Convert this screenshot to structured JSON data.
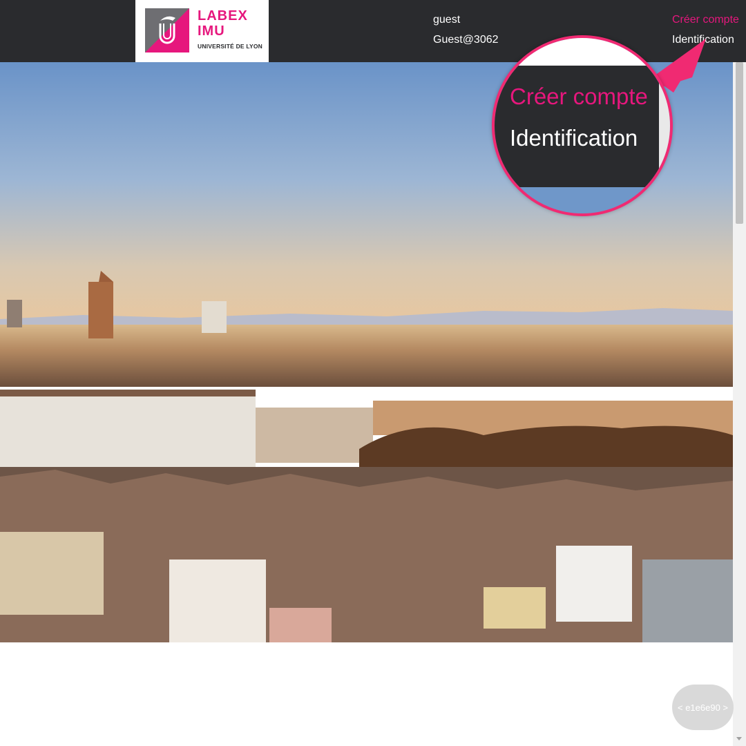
{
  "header": {
    "logo": {
      "line1": "LABEX",
      "line2": "IMU",
      "subtitle": "UNIVERSITÉ DE LYON"
    },
    "user": {
      "name": "guest",
      "id": "Guest@3062"
    },
    "links": {
      "create_account": "Créer compte",
      "login": "Identification"
    }
  },
  "magnifier": {
    "create_account": "Créer compte",
    "login": "Identification"
  },
  "hero": {
    "image": "lyon-city-panorama"
  },
  "color_pill": {
    "label": "< e1e6e90 >"
  },
  "colors": {
    "header_bg": "#2a2b2e",
    "brand_pink": "#e6177d",
    "callout_border": "#f02a72"
  }
}
